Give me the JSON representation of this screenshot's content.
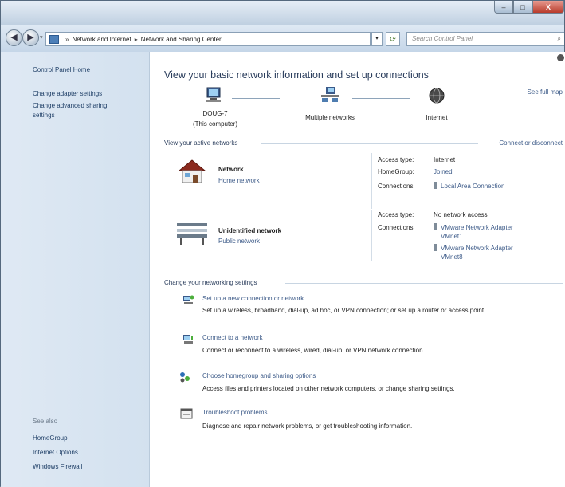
{
  "window": {
    "minimize": "–",
    "maximize": "□",
    "close": "X"
  },
  "address": {
    "crumbs": [
      "Network and Internet",
      "Network and Sharing Center"
    ],
    "search_placeholder": "Search Control Panel"
  },
  "sidebar": {
    "home": "Control Panel Home",
    "links": [
      "Change adapter settings",
      "Change advanced sharing",
      "settings"
    ],
    "see_also": "See also",
    "see_also_items": [
      "HomeGroup",
      "Internet Options",
      "Windows Firewall"
    ]
  },
  "main": {
    "title": "View your basic network information and set up connections",
    "see_full_map": "See full map",
    "map": {
      "computer_name": "DOUG-7",
      "computer_sub": "(This computer)",
      "networks": "Multiple networks",
      "internet": "Internet"
    },
    "active_title": "View your active networks",
    "connect_link": "Connect or disconnect",
    "networks": [
      {
        "name": "Network",
        "type": "Home network",
        "access_label": "Access type:",
        "access": "Internet",
        "homegroup_label": "HomeGroup:",
        "homegroup": "Joined",
        "conn_label": "Connections:",
        "conn": "Local Area Connection"
      },
      {
        "name": "Unidentified network",
        "type": "Public network",
        "access_label": "Access type:",
        "access": "No network access",
        "conn_label": "Connections:",
        "conn1a": "VMware Network Adapter",
        "conn1b": "VMnet1",
        "conn2a": "VMware Network Adapter",
        "conn2b": "VMnet8"
      }
    ],
    "change_title": "Change your networking settings",
    "tasks": [
      {
        "title": "Set up a new connection or network",
        "desc": "Set up a wireless, broadband, dial-up, ad hoc, or VPN connection; or set up a router or access point."
      },
      {
        "title": "Connect to a network",
        "desc": "Connect or reconnect to a wireless, wired, dial-up, or VPN network connection."
      },
      {
        "title": "Choose homegroup and sharing options",
        "desc": "Access files and printers located on other network computers, or change sharing settings."
      },
      {
        "title": "Troubleshoot problems",
        "desc": "Diagnose and repair network problems, or get troubleshooting information."
      }
    ]
  },
  "icons": {
    "back": "◀",
    "forward": "▶",
    "dropdown": "▾",
    "refresh": "⟳",
    "search": "⌕"
  }
}
